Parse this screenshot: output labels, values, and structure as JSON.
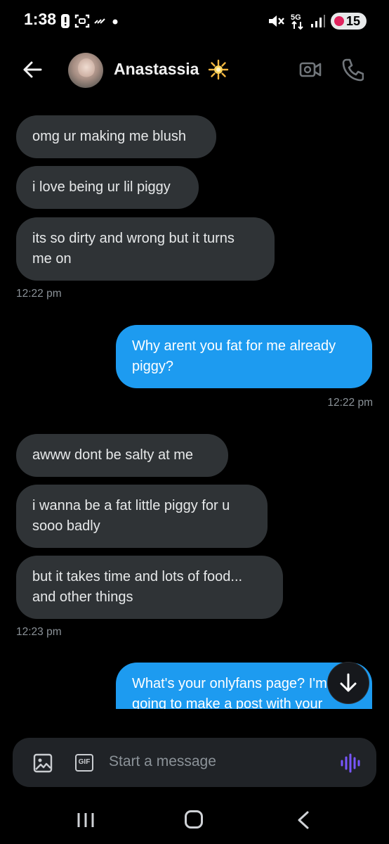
{
  "status_bar": {
    "time": "1:38",
    "battery": "15",
    "network": "5G"
  },
  "header": {
    "contact_name": "Anastassia",
    "name_emoji": "sparkle-star",
    "back_icon": "arrow-left-icon",
    "video_icon": "video-camera-icon",
    "phone_icon": "phone-icon"
  },
  "messages": [
    {
      "direction": "in",
      "text": "omg ur making me blush"
    },
    {
      "direction": "in",
      "text": "i love being ur lil piggy"
    },
    {
      "direction": "in",
      "text": "its so dirty and wrong but it turns\nme on"
    },
    {
      "direction": "in",
      "timestamp": "12:22 pm"
    },
    {
      "direction": "out",
      "text": "Why arent you fat for me already\npiggy?"
    },
    {
      "direction": "out",
      "timestamp": "12:22 pm"
    },
    {
      "direction": "in",
      "text": "awww dont be salty at me"
    },
    {
      "direction": "in",
      "text": "i wanna be a fat little piggy for u\nsooo badly"
    },
    {
      "direction": "in",
      "text": "but it takes time and lots of food...\nand other things"
    },
    {
      "direction": "in",
      "timestamp": "12:23 pm"
    },
    {
      "direction": "out",
      "text": "What's your onlyfans page? I'm\ngoing to make a post with your\nphotos and our chats about how"
    }
  ],
  "composer": {
    "placeholder": "Start a message",
    "gif_label": "GIF"
  },
  "colors": {
    "background": "#000000",
    "incoming_bubble": "#2f3336",
    "outgoing_bubble": "#1d9bf0",
    "voice_accent": "#7856ff"
  }
}
